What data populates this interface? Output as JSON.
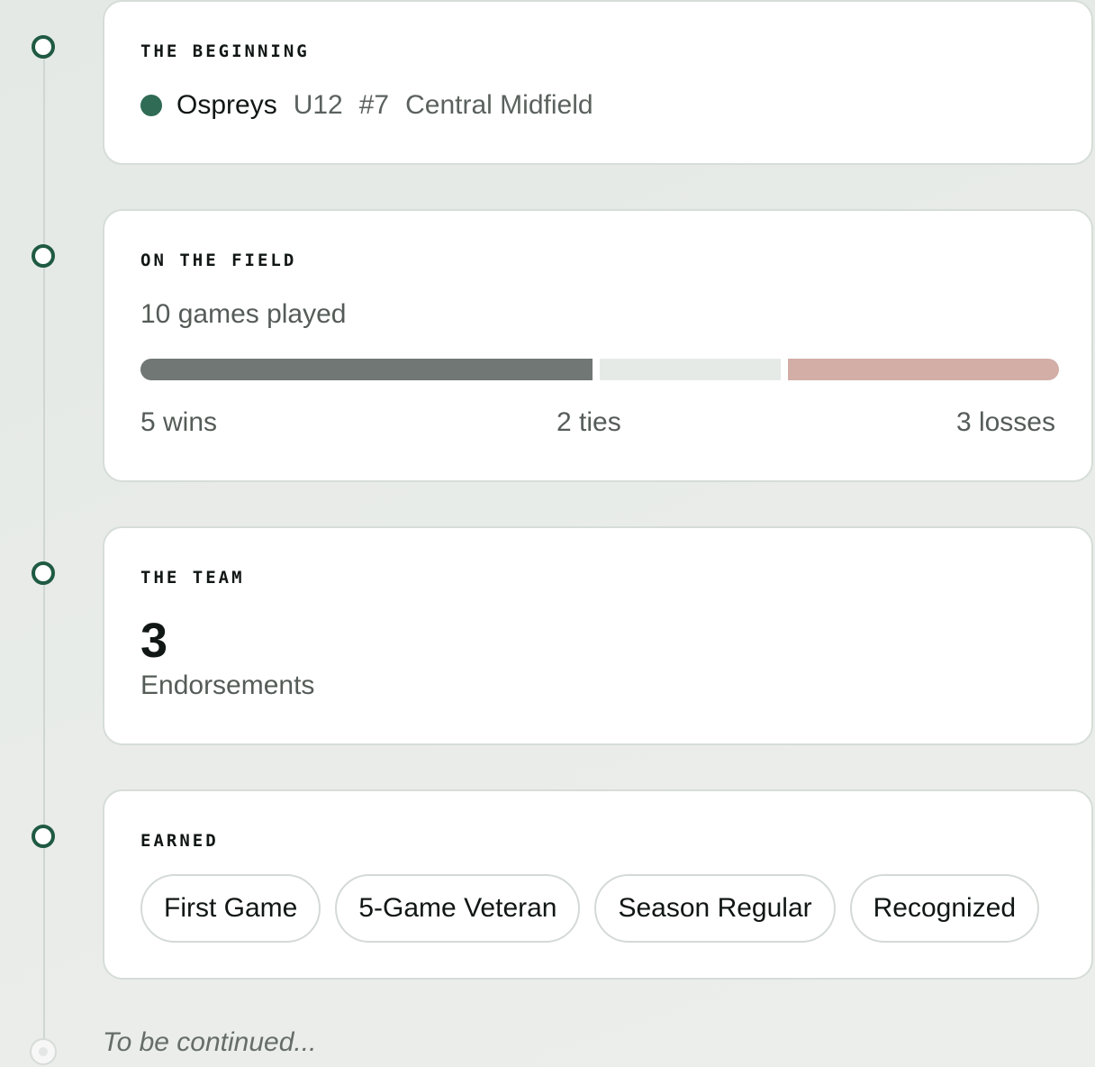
{
  "beginning": {
    "heading": "THE BEGINNING",
    "team_name": "Ospreys",
    "age_group": "U12",
    "number": "#7",
    "position": "Central Midfield",
    "team_color": "#2f6b55"
  },
  "field": {
    "heading": "ON THE FIELD",
    "games_played": "10 games played",
    "wins": 5,
    "ties": 2,
    "losses": 3,
    "wins_label": "5 wins",
    "ties_label": "2 ties",
    "losses_label": "3 losses",
    "colors": {
      "wins": "#717774",
      "ties": "#e6eae7",
      "losses": "#d2aea7"
    }
  },
  "team": {
    "heading": "THE TEAM",
    "endorsements_count": "3",
    "endorsements_label": "Endorsements"
  },
  "earned": {
    "heading": "EARNED",
    "badges": [
      "First Game",
      "5-Game Veteran",
      "Season Regular",
      "Recognized"
    ]
  },
  "footer": {
    "continued": "To be continued..."
  },
  "accent_color": "#1f5a42"
}
